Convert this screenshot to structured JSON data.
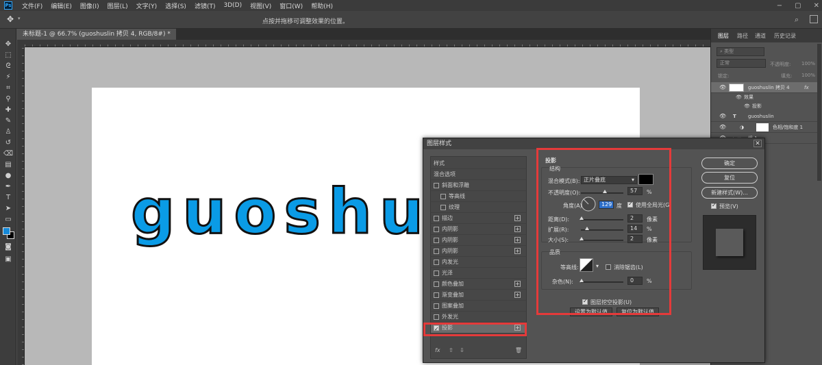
{
  "menubar": {
    "logo": "Ps",
    "items": [
      "文件(F)",
      "编辑(E)",
      "图像(I)",
      "图层(L)",
      "文字(Y)",
      "选择(S)",
      "滤镜(T)",
      "3D(D)",
      "视图(V)",
      "窗口(W)",
      "帮助(H)"
    ],
    "window_controls": [
      "−",
      "▢",
      "✕"
    ]
  },
  "options_bar": {
    "hint": "点按并拖移可调整效果的位置。",
    "move_icon": "move-icon",
    "search_icon": "search-icon"
  },
  "document": {
    "tab_title": "未标题-1 @ 66.7% (guoshuslin 拷贝 4, RGB/8#) *",
    "canvas_text": "guoshu"
  },
  "layers_panel": {
    "tabs": [
      "图层",
      "路径",
      "通道",
      "历史记录"
    ],
    "kind_filter": "类型",
    "blend_mode": "正常",
    "opacity_label": "不透明度:",
    "opacity_value": "100%",
    "lock_label": "锁定:",
    "fill_label": "填充:",
    "fill_value": "100%",
    "layers": [
      {
        "name": "guoshuslin 拷贝 4",
        "fx": "fx"
      },
      {
        "name": "效果"
      },
      {
        "name": "投影"
      },
      {
        "name": "guoshuslin",
        "type": "T"
      },
      {
        "name": "色相/饱和度 1"
      },
      {
        "name": "组 1"
      }
    ]
  },
  "dialog": {
    "title": "图层样式",
    "close": "✕",
    "styles_header": "样式",
    "blend_options": "混合选项",
    "style_items": [
      {
        "label": "斜面和浮雕",
        "checked": false,
        "plus": false,
        "indent": false
      },
      {
        "label": "等高线",
        "checked": false,
        "plus": false,
        "indent": true
      },
      {
        "label": "纹理",
        "checked": false,
        "plus": false,
        "indent": true
      },
      {
        "label": "描边",
        "checked": false,
        "plus": true,
        "indent": false
      },
      {
        "label": "内阴影",
        "checked": false,
        "plus": true,
        "indent": false
      },
      {
        "label": "内阴影",
        "checked": false,
        "plus": true,
        "indent": false
      },
      {
        "label": "内阴影",
        "checked": false,
        "plus": true,
        "indent": false
      },
      {
        "label": "内发光",
        "checked": false,
        "plus": false,
        "indent": false
      },
      {
        "label": "光泽",
        "checked": false,
        "plus": false,
        "indent": false
      },
      {
        "label": "颜色叠加",
        "checked": false,
        "plus": true,
        "indent": false
      },
      {
        "label": "渐变叠加",
        "checked": false,
        "plus": true,
        "indent": false
      },
      {
        "label": "图案叠加",
        "checked": false,
        "plus": false,
        "indent": false
      },
      {
        "label": "外发光",
        "checked": false,
        "plus": false,
        "indent": false
      },
      {
        "label": "投影",
        "checked": true,
        "plus": true,
        "indent": false,
        "selected": true
      }
    ],
    "footer": {
      "fx": "fx",
      "up": "⇧",
      "down": "⇩",
      "trash": "🗑"
    },
    "drop_shadow": {
      "section_title": "投影",
      "structure": "结构",
      "blend_mode_label": "混合模式(B):",
      "blend_mode_value": "正片叠底",
      "shadow_color": "#000000",
      "opacity_label": "不透明度(O):",
      "opacity_value": "57",
      "opacity_pct": 57,
      "angle_label": "角度(A):",
      "angle_value": "129",
      "angle_unit": "度",
      "global_light": "使用全局光(G)",
      "distance_label": "距离(D):",
      "distance_value": "2",
      "spread_label": "扩展(R):",
      "spread_value": "14",
      "size_label": "大小(S):",
      "size_value": "2",
      "px_unit": "像素",
      "pct_unit": "%",
      "quality": "品质",
      "contour_label": "等高线:",
      "antialias": "消除锯齿(L)",
      "noise_label": "杂色(N):",
      "noise_value": "0",
      "knockout": "图层挖空投影(U)",
      "set_default": "设置为默认值",
      "reset_default": "复位为默认值"
    },
    "buttons": {
      "ok": "确定",
      "reset": "复位",
      "new_style": "新建样式(W)...",
      "preview": "预览(V)"
    }
  }
}
